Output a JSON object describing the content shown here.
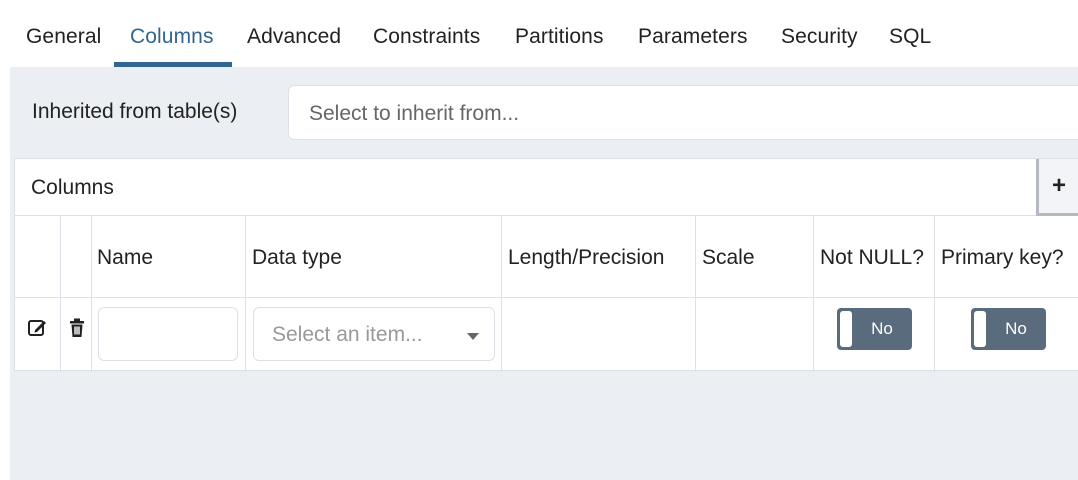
{
  "tabs": [
    {
      "label": "General"
    },
    {
      "label": "Columns",
      "active": true
    },
    {
      "label": "Advanced"
    },
    {
      "label": "Constraints"
    },
    {
      "label": "Partitions"
    },
    {
      "label": "Parameters"
    },
    {
      "label": "Security"
    },
    {
      "label": "SQL"
    }
  ],
  "inherit": {
    "label": "Inherited from table(s)",
    "placeholder": "Select to inherit from..."
  },
  "columns_panel": {
    "title": "Columns",
    "add_label": "+",
    "headers": {
      "name": "Name",
      "data_type": "Data type",
      "length_precision": "Length/Precision",
      "scale": "Scale",
      "not_null": "Not NULL?",
      "primary_key": "Primary key?"
    },
    "row": {
      "name_value": "",
      "data_type_placeholder": "Select an item...",
      "not_null": "No",
      "primary_key": "No"
    }
  },
  "icons": {
    "edit": "edit-icon",
    "delete": "trash-icon",
    "add": "plus-icon",
    "dropdown": "chevron-down-icon"
  },
  "colors": {
    "accent": "#326690",
    "toggle_bg": "#5a6b7e",
    "background": "#ebeef3",
    "border": "#dde0e6"
  }
}
